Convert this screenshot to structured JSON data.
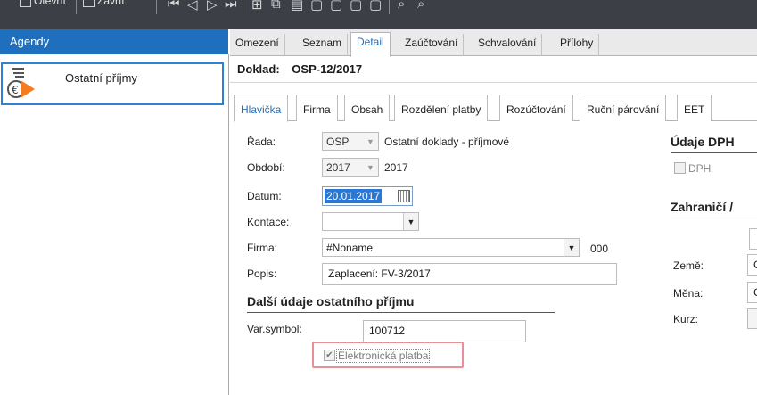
{
  "toolbar": {
    "items": [
      "Otevřít",
      "Zavřít"
    ]
  },
  "sidebar": {
    "header": "Agendy",
    "items": [
      {
        "label": "Ostatní příjmy",
        "icon": "incoming-payment-icon"
      }
    ]
  },
  "top_tabs": [
    {
      "label": "Omezení",
      "active": false
    },
    {
      "label": "Seznam",
      "active": false
    },
    {
      "label": "Detail",
      "active": true
    },
    {
      "label": "Zaúčtování",
      "active": false
    },
    {
      "label": "Schvalování",
      "active": false
    },
    {
      "label": "Přílohy",
      "active": false
    }
  ],
  "doklad": {
    "label": "Doklad:",
    "value": "OSP-12/2017"
  },
  "sub_tabs": [
    {
      "label": "Hlavička",
      "active": true
    },
    {
      "label": "Firma",
      "active": false
    },
    {
      "label": "Obsah",
      "active": false
    },
    {
      "label": "Rozdělení platby",
      "active": false
    },
    {
      "label": "Rozúčtování",
      "active": false
    },
    {
      "label": "Ruční párování",
      "active": false
    },
    {
      "label": "EET",
      "active": false
    }
  ],
  "form": {
    "rada": {
      "label": "Řada:",
      "value": "OSP",
      "description": "Ostatní doklady - příjmové"
    },
    "obdobi": {
      "label": "Období:",
      "value": "2017",
      "description": "2017"
    },
    "datum": {
      "label": "Datum:",
      "value": "20.01.2017"
    },
    "kontace": {
      "label": "Kontace:",
      "value": ""
    },
    "firma": {
      "label": "Firma:",
      "value": "#Noname",
      "code": "000"
    },
    "popis": {
      "label": "Popis:",
      "value": "Zaplacení: FV-3/2017"
    }
  },
  "dalsi_udaje": {
    "title": "Další údaje ostatního příjmu",
    "var_symbol": {
      "label": "Var.symbol:",
      "value": "100712"
    },
    "elektronicka_platba": {
      "label": "Elektronická platba",
      "checked": true,
      "disabled": true
    }
  },
  "udaje_dph": {
    "title": "Údaje DPH",
    "dph": {
      "label": "DPH",
      "checked": false
    }
  },
  "zahranici": {
    "title": "Zahraničí /",
    "zeme": {
      "label": "Země:",
      "value": "C"
    },
    "mena": {
      "label": "Měna:",
      "value": "C"
    },
    "kurz": {
      "label": "Kurz:",
      "value": ""
    }
  },
  "colors": {
    "accent": "#1f6fbf",
    "toolbar_bg": "#3c3f46",
    "highlight_box": "#e98f96"
  }
}
